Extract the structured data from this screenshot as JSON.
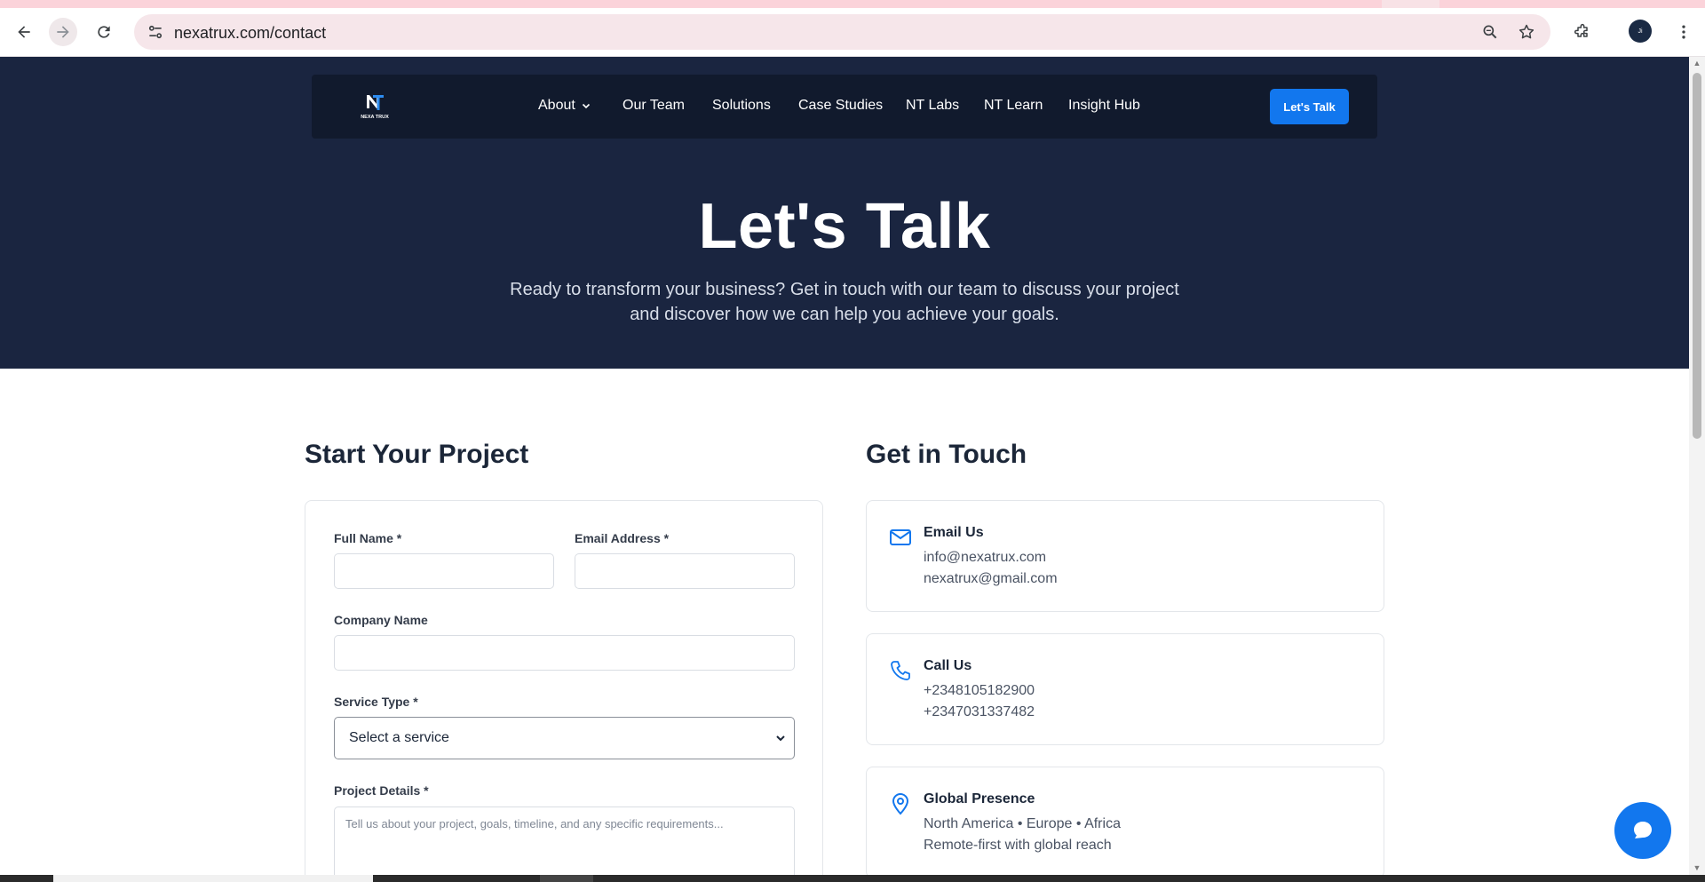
{
  "browser": {
    "url": "nexatrux.com/contact",
    "profile_initial": "Ji"
  },
  "nav": {
    "logo_text": "NEXA TRUX",
    "links": [
      "About",
      "Our Team",
      "Solutions",
      "Case Studies",
      "NT Labs",
      "NT Learn",
      "Insight Hub"
    ],
    "cta": "Let's Talk"
  },
  "hero": {
    "title": "Let's Talk",
    "subtitle": "Ready to transform your business? Get in touch with our team to discuss your project and discover how we can help you achieve your goals."
  },
  "form": {
    "title": "Start Your Project",
    "full_name_label": "Full Name *",
    "email_label": "Email Address *",
    "company_label": "Company Name",
    "service_label": "Service Type *",
    "service_selected": "Select a service",
    "details_label": "Project Details *",
    "details_placeholder": "Tell us about your project, goals, timeline, and any specific requirements..."
  },
  "contact": {
    "title": "Get in Touch",
    "cards": [
      {
        "title": "Email Us",
        "lines": [
          "info@nexatrux.com",
          "nexatrux@gmail.com"
        ],
        "icon": "mail-icon"
      },
      {
        "title": "Call Us",
        "lines": [
          "+2348105182900",
          "+2347031337482"
        ],
        "icon": "phone-icon"
      },
      {
        "title": "Global Presence",
        "lines": [
          "North America • Europe • Africa",
          "Remote-first with global reach"
        ],
        "icon": "map-pin-icon"
      }
    ]
  },
  "colors": {
    "hero_bg": "#1a2540",
    "nav_bg": "#111a2d",
    "accent": "#1277ee"
  }
}
